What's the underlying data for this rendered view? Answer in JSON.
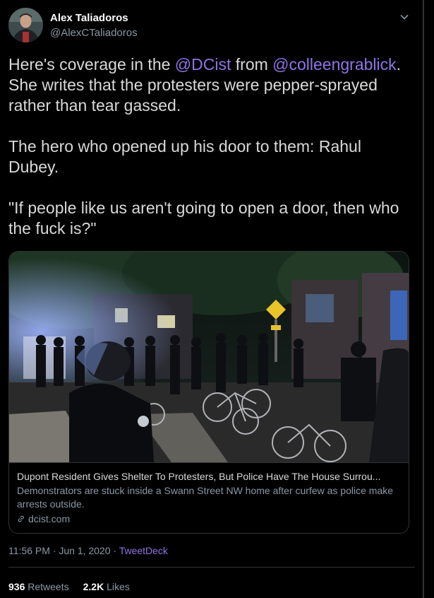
{
  "author": {
    "name": "Alex Taliadoros",
    "handle": "@AlexCTaliadoros",
    "avatar_icon": "profile-photo"
  },
  "tweet": {
    "p1_a": "Here's coverage in the ",
    "p1_mention1": "@DCist",
    "p1_b": " from ",
    "p1_mention2": "@colleengrablick",
    "p1_c": ". She writes that the protesters were pepper-sprayed rather than tear gassed.",
    "p2": "The hero who opened up his door to them: Rahul Dubey.",
    "p3": "\"If people like us aren't going to open a door, then who the fuck is?\""
  },
  "card": {
    "title": "Dupont Resident Gives Shelter To Protesters, But Police Have The House Surrou...",
    "description": "Demonstrators are stuck inside a Swann Street NW home after curfew as police make arrests outside.",
    "domain": "dcist.com",
    "link_icon": "link-icon",
    "image_alt": "police-and-bicycles-night-photo"
  },
  "meta": {
    "time": "11:56 PM · Jun 1, 2020 · ",
    "source": "TweetDeck"
  },
  "stats": {
    "retweets_count": "936",
    "retweets_label": "Retweets",
    "likes_count": "2.2K",
    "likes_label": "Likes"
  },
  "colors": {
    "background": "#000000",
    "text": "#d9d9d9",
    "secondary": "#8b98a5",
    "accent": "#8f74e6",
    "border": "#2f3336"
  }
}
